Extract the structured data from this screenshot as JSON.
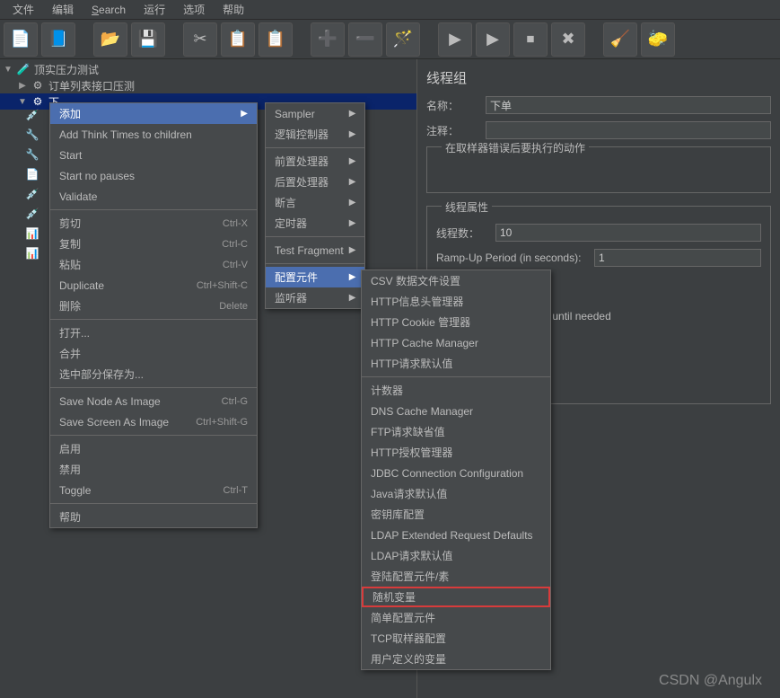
{
  "menubar": [
    {
      "label": "文件"
    },
    {
      "label": "编辑"
    },
    {
      "label": "Search",
      "underline": true
    },
    {
      "label": "运行"
    },
    {
      "label": "选项"
    },
    {
      "label": "帮助"
    }
  ],
  "toolbar_icons": [
    {
      "name": "new-icon",
      "glyph": "📄"
    },
    {
      "name": "template-icon",
      "glyph": "📘"
    },
    {
      "sep": true
    },
    {
      "name": "open-icon",
      "glyph": "📂"
    },
    {
      "name": "save-icon",
      "glyph": "💾"
    },
    {
      "sep": true
    },
    {
      "name": "cut-icon",
      "glyph": "✂"
    },
    {
      "name": "copy-icon",
      "glyph": "📋"
    },
    {
      "name": "paste-icon",
      "glyph": "📋"
    },
    {
      "sep": true
    },
    {
      "name": "plus-icon",
      "glyph": "➕"
    },
    {
      "name": "minus-icon",
      "glyph": "➖"
    },
    {
      "name": "wand-icon",
      "glyph": "🪄"
    },
    {
      "sep": true
    },
    {
      "name": "run-icon",
      "glyph": "▶"
    },
    {
      "name": "run-remote-icon",
      "glyph": "▶"
    },
    {
      "name": "stop-icon",
      "glyph": "⏹"
    },
    {
      "name": "shutdown-icon",
      "glyph": "✖"
    },
    {
      "sep": true
    },
    {
      "name": "clear-icon",
      "glyph": "🧹"
    },
    {
      "name": "clear-all-icon",
      "glyph": "🧽"
    }
  ],
  "tree": {
    "root": "顶实压力测试",
    "l1": "订单列表接口压测",
    "l2": "下"
  },
  "context_main": [
    {
      "label": "添加",
      "arrow": true,
      "hl": true
    },
    {
      "label": "Add Think Times to children"
    },
    {
      "label": "Start"
    },
    {
      "label": "Start no pauses"
    },
    {
      "label": "Validate"
    },
    {
      "sep": true
    },
    {
      "label": "剪切",
      "shortcut": "Ctrl-X"
    },
    {
      "label": "复制",
      "shortcut": "Ctrl-C"
    },
    {
      "label": "粘贴",
      "shortcut": "Ctrl-V"
    },
    {
      "label": "Duplicate",
      "shortcut": "Ctrl+Shift-C"
    },
    {
      "label": "删除",
      "shortcut": "Delete"
    },
    {
      "sep": true
    },
    {
      "label": "打开..."
    },
    {
      "label": "合并"
    },
    {
      "label": "选中部分保存为..."
    },
    {
      "sep": true
    },
    {
      "label": "Save Node As Image",
      "shortcut": "Ctrl-G"
    },
    {
      "label": "Save Screen As Image",
      "shortcut": "Ctrl+Shift-G"
    },
    {
      "sep": true
    },
    {
      "label": "启用"
    },
    {
      "label": "禁用"
    },
    {
      "label": "Toggle",
      "shortcut": "Ctrl-T"
    },
    {
      "sep": true
    },
    {
      "label": "帮助"
    }
  ],
  "context_sub": [
    {
      "label": "Sampler",
      "arrow": true
    },
    {
      "label": "逻辑控制器",
      "arrow": true
    },
    {
      "sep": true
    },
    {
      "label": "前置处理器",
      "arrow": true
    },
    {
      "label": "后置处理器",
      "arrow": true
    },
    {
      "label": "断言",
      "arrow": true
    },
    {
      "label": "定时器",
      "arrow": true
    },
    {
      "sep": true
    },
    {
      "label": "Test Fragment",
      "arrow": true
    },
    {
      "sep": true
    },
    {
      "label": "配置元件",
      "arrow": true,
      "hl": true
    },
    {
      "label": "监听器",
      "arrow": true
    }
  ],
  "context_config": [
    {
      "label": "CSV 数据文件设置"
    },
    {
      "label": "HTTP信息头管理器"
    },
    {
      "label": "HTTP Cookie 管理器"
    },
    {
      "label": "HTTP Cache Manager"
    },
    {
      "label": "HTTP请求默认值"
    },
    {
      "sep": true
    },
    {
      "label": "计数器"
    },
    {
      "label": "DNS Cache Manager"
    },
    {
      "label": "FTP请求缺省值"
    },
    {
      "label": "HTTP授权管理器"
    },
    {
      "label": "JDBC Connection Configuration"
    },
    {
      "label": "Java请求默认值"
    },
    {
      "label": "密钥库配置"
    },
    {
      "label": "LDAP Extended Request Defaults"
    },
    {
      "label": "LDAP请求默认值"
    },
    {
      "label": "登陆配置元件/素"
    },
    {
      "label": "随机变量",
      "red": true
    },
    {
      "label": "简单配置元件"
    },
    {
      "label": "TCP取样器配置"
    },
    {
      "label": "用户定义的变量"
    }
  ],
  "panel": {
    "title": "线程组",
    "name_label": "名称：",
    "name_value": "下单",
    "comment_label": "注释：",
    "error_label": "在取样器错误后要执行的动作",
    "thread_props_label": "线程属性",
    "threads_label": "线程数：",
    "threads_value": "10",
    "rampup_label": "Ramp-Up Period (in seconds):",
    "rampup_value": "1",
    "delay_text": "ion until needed"
  },
  "watermark": "CSDN @Angulx"
}
